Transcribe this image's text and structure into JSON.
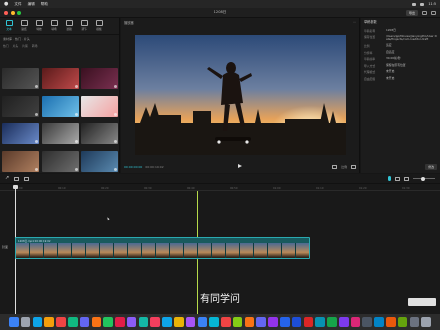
{
  "menubar": {
    "items": [
      "文件",
      "编辑",
      "帮助"
    ],
    "clock": "11:5"
  },
  "window": {
    "title": "1208日",
    "export_label": "导出"
  },
  "media": {
    "tools": [
      {
        "label": "文本",
        "icon": "text-icon",
        "active": true
      },
      {
        "label": "贴纸",
        "icon": "sticker-icon",
        "active": false
      },
      {
        "label": "特效",
        "icon": "effects-icon",
        "active": false
      },
      {
        "label": "转场",
        "icon": "transition-icon",
        "active": false
      },
      {
        "label": "滤镜",
        "icon": "filter-icon",
        "active": false
      },
      {
        "label": "调节",
        "icon": "adjust-icon",
        "active": false
      },
      {
        "label": "模板",
        "icon": "template-icon",
        "active": false
      }
    ],
    "breadcrumb": "素材库 · 热门 · 片头",
    "subtabs": [
      "热门",
      "片头",
      "片尾",
      "转场"
    ],
    "thumbs": [
      {
        "label": "",
        "bg": "linear-gradient(135deg,#2a2a2a,#555)"
      },
      {
        "label": "",
        "bg": "linear-gradient(135deg,#5a1a1a,#c04a4a)"
      },
      {
        "label": "",
        "bg": "linear-gradient(135deg,#3a1020,#7a3050)"
      },
      {
        "label": "",
        "bg": "linear-gradient(135deg,#202020,#404040)"
      },
      {
        "label": "",
        "bg": "linear-gradient(135deg,#1b6fb0,#6fc0e8)"
      },
      {
        "label": "",
        "bg": "linear-gradient(135deg,#e7e7e7,#f5a0a0)"
      },
      {
        "label": "",
        "bg": "linear-gradient(135deg,#1a2d5a,#6a8ac8)"
      },
      {
        "label": "",
        "bg": "linear-gradient(135deg,#3a3a3a,#aaaaaa)"
      },
      {
        "label": "",
        "bg": "linear-gradient(135deg,#222,#888)"
      },
      {
        "label": "",
        "bg": "linear-gradient(135deg,#5a3a2a,#b08060)"
      },
      {
        "label": "",
        "bg": "linear-gradient(135deg,#2e2e2e,#6e6e6e)"
      },
      {
        "label": "",
        "bg": "linear-gradient(135deg,#1e3a5a,#5a8ab0)"
      },
      {
        "label": "",
        "bg": "linear-gradient(135deg,#b05a2a,#e0c090)"
      },
      {
        "label": "",
        "bg": "linear-gradient(135deg,#9a1010,#d02020)"
      },
      {
        "label": "",
        "bg": "linear-gradient(135deg,#e8d0d0,#f0a0a8)"
      },
      {
        "label": "",
        "bg": "linear-gradient(135deg,#c8c8c8,#eeeeee)"
      },
      {
        "label": "",
        "bg": "linear-gradient(135deg,#e0c080,#f0e0b0)"
      },
      {
        "label": "",
        "bg": "linear-gradient(135deg,#c02030,#e06070)"
      }
    ]
  },
  "player": {
    "header": "播放器",
    "current_time": "00:00:00:00",
    "total_time": "00:00:19:02",
    "ratio_label": "比例"
  },
  "props": {
    "header": "草稿参数",
    "rows": [
      {
        "k": "草稿名称",
        "v": "1208日"
      },
      {
        "k": "保存位置",
        "v": "/Users/pp/Movies/JianyingPro/User Data/Projects/com.lveditor.draft"
      },
      {
        "k": "比例",
        "v": "适应"
      },
      {
        "k": "分辨率",
        "v": "自适应"
      },
      {
        "k": "草稿帧率",
        "v": "30.00帧/秒"
      },
      {
        "k": "导入方式",
        "v": "保留在原有位置"
      },
      {
        "k": "代理模式",
        "v": "未开启"
      },
      {
        "k": "自由层级",
        "v": "未开启"
      }
    ],
    "modify_label": "修改"
  },
  "timeline": {
    "ticks": [
      {
        "label": "00:00"
      },
      {
        "label": "00:10"
      },
      {
        "label": "00:20"
      },
      {
        "label": "00:30"
      },
      {
        "label": "00:40"
      },
      {
        "label": "00:50"
      },
      {
        "label": "01:00"
      },
      {
        "label": "01:10"
      },
      {
        "label": "01:20"
      },
      {
        "label": "01:30"
      }
    ],
    "track_label": "封面",
    "clip_name": "1208日.mp4  00:00:19:02",
    "subtitle": "有同学问"
  },
  "dock": {
    "apps": [
      "#3b82f6",
      "#9ca3af",
      "#0ea5e9",
      "#f59e0b",
      "#ef4444",
      "#10b981",
      "#6366f1",
      "#f97316",
      "#22c55e",
      "#e11d48",
      "#8b5cf6",
      "#14b8a6",
      "#f43f5e",
      "#0ea5e9",
      "#eab308",
      "#a855f7",
      "#3b82f6",
      "#06b6d4",
      "#ef4444",
      "#84cc16",
      "#f97316",
      "#6366f1",
      "#9333ea",
      "#2563eb",
      "#1d4ed8",
      "#dc2626",
      "#0891b2",
      "#16a34a",
      "#7c3aed",
      "#db2777",
      "#4b5563",
      "#0284c7",
      "#ea580c",
      "#65a30d",
      "#6b7280",
      "#9ca3af"
    ]
  }
}
